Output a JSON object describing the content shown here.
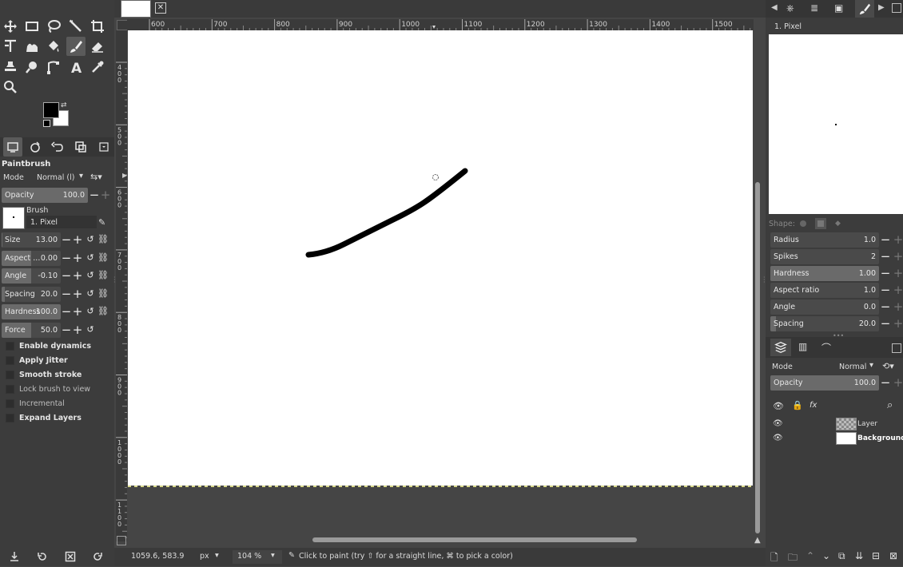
{
  "colors": {
    "panel": "#3c3c3c",
    "canvas_bg": "#454545",
    "image": "#ffffff",
    "stroke": "#000000",
    "slider_fill": "#6a6a6a"
  },
  "toolbox": {
    "tools": [
      "move-icon",
      "rect-select-icon",
      "lasso-icon",
      "fuzzy-select-icon",
      "crop-icon",
      "transform-icon",
      "warp-icon",
      "bucket-fill-icon",
      "paintbrush-icon",
      "eraser-icon",
      "clone-icon",
      "smudge-icon",
      "paths-icon",
      "text-icon",
      "color-picker-icon",
      "zoom-icon"
    ],
    "title": "Paintbrush",
    "mode_label": "Mode",
    "mode_value": "Normal (l)",
    "opacity": {
      "label": "Opacity",
      "value": "100.0",
      "fraction": 1.0
    },
    "brush_label": "Brush",
    "brush_name": "1. Pixel",
    "sliders": [
      {
        "label": "Size",
        "value": "13.00",
        "fraction": 0.02
      },
      {
        "label": "Aspect ...",
        "value": "0.00",
        "fraction": 0.5
      },
      {
        "label": "Angle",
        "value": "-0.10",
        "fraction": 0.5
      },
      {
        "label": "Spacing",
        "value": "20.0",
        "fraction": 0.05
      },
      {
        "label": "Hardness",
        "value": "100.0",
        "fraction": 1.0
      },
      {
        "label": "Force",
        "value": "50.0",
        "fraction": 0.5
      }
    ],
    "options": [
      {
        "label": "Enable dynamics",
        "bold": true
      },
      {
        "label": "Apply Jitter",
        "bold": true
      },
      {
        "label": "Smooth stroke",
        "bold": true
      },
      {
        "label": "Lock brush to view",
        "bold": false
      },
      {
        "label": "Incremental",
        "bold": false
      },
      {
        "label": "Expand Layers",
        "bold": true
      }
    ]
  },
  "rulers": {
    "h_labels": [
      "600",
      "700",
      "800",
      "900",
      "1000",
      "1100",
      "1200",
      "1300",
      "1400",
      "1500"
    ],
    "v_labels": [
      "4\n0\n0",
      "5\n0\n0",
      "6\n0\n0",
      "7\n0\n0",
      "8\n0\n0",
      "9\n0\n0",
      "1\n0\n0\n0",
      "1\n1\n0\n0"
    ]
  },
  "status": {
    "coords": "1059.6, 583.9",
    "unit": "px",
    "zoom": "104 %",
    "message": "Click to paint (try ⇧ for a straight line, ⌘ to pick a color)"
  },
  "brush_panel": {
    "brush_name": "1. Pixel",
    "shape_label": "Shape:",
    "params": [
      {
        "label": "Radius",
        "value": "1.0",
        "fraction": 0.0
      },
      {
        "label": "Spikes",
        "value": "2",
        "fraction": 0.0
      },
      {
        "label": "Hardness",
        "value": "1.00",
        "fraction": 1.0
      },
      {
        "label": "Aspect ratio",
        "value": "1.0",
        "fraction": 0.0
      },
      {
        "label": "Angle",
        "value": "0.0",
        "fraction": 0.0
      },
      {
        "label": "Spacing",
        "value": "20.0",
        "fraction": 0.05
      }
    ]
  },
  "layers_panel": {
    "mode_label": "Mode",
    "mode_value": "Normal",
    "opacity": {
      "label": "Opacity",
      "value": "100.0",
      "fraction": 1.0
    },
    "layers": [
      {
        "name": "Layer",
        "bold": false
      },
      {
        "name": "Background",
        "bold": true
      }
    ]
  }
}
